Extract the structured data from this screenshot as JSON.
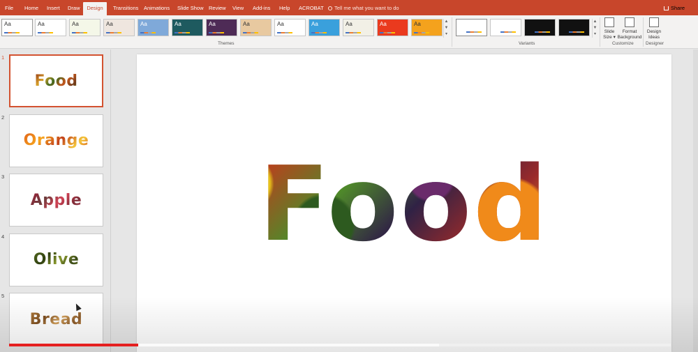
{
  "tabs": [
    {
      "label": "File",
      "active": false
    },
    {
      "label": "Home",
      "active": false
    },
    {
      "label": "Insert",
      "active": false
    },
    {
      "label": "Draw",
      "active": false
    },
    {
      "label": "Design",
      "active": true
    },
    {
      "label": "Transitions",
      "active": false
    },
    {
      "label": "Animations",
      "active": false
    },
    {
      "label": "Slide Show",
      "active": false
    },
    {
      "label": "Review",
      "active": false
    },
    {
      "label": "View",
      "active": false
    },
    {
      "label": "Add-ins",
      "active": false
    },
    {
      "label": "Help",
      "active": false
    },
    {
      "label": "ACROBAT",
      "active": false
    }
  ],
  "tell_me": "Tell me what you want to do",
  "share": "Share",
  "ribbon": {
    "themes_label": "Themes",
    "variants_label": "Variants",
    "customize_label": "Customize",
    "designer_label": "Designer",
    "theme_sample": "Aa",
    "themes": [
      {
        "bg": "#ffffff"
      },
      {
        "bg": "#ffffff"
      },
      {
        "bg": "#f4f7e8"
      },
      {
        "bg": "#efe6df"
      },
      {
        "bg": "#7fa9d9"
      },
      {
        "bg": "#1e5a5f"
      },
      {
        "bg": "#4e2b56"
      },
      {
        "bg": "#e8c9a0"
      },
      {
        "bg": "#ffffff"
      },
      {
        "bg": "#3aa0dc"
      },
      {
        "bg": "#f2f0e6"
      },
      {
        "bg": "#ea3a1e"
      },
      {
        "bg": "#f4a21d"
      }
    ],
    "variants": [
      {
        "bg": "#ffffff"
      },
      {
        "bg": "#ffffff"
      },
      {
        "bg": "#111111"
      },
      {
        "bg": "#111111"
      }
    ],
    "slide_size": [
      "Slide",
      "Size ▾"
    ],
    "format_background": [
      "Format",
      "Background"
    ],
    "design_ideas": [
      "Design",
      "Ideas"
    ]
  },
  "slides": [
    {
      "number": "1",
      "title": "Food",
      "style": "t-food",
      "selected": true
    },
    {
      "number": "2",
      "title": "Orange",
      "style": "t-orange",
      "selected": false
    },
    {
      "number": "3",
      "title": "Apple",
      "style": "t-apple",
      "selected": false
    },
    {
      "number": "4",
      "title": "Olive",
      "style": "t-olive",
      "selected": false
    },
    {
      "number": "5",
      "title": "Bread",
      "style": "t-bread",
      "selected": false
    }
  ],
  "main_slide": {
    "title": "Food"
  },
  "video_progress": {
    "played": 0.195,
    "buffered": 0.65
  }
}
